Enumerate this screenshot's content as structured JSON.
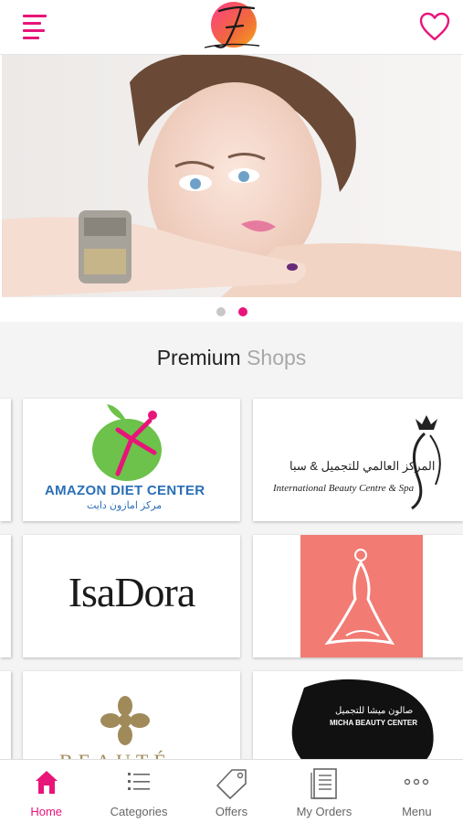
{
  "colors": {
    "accent": "#e8147a",
    "muted_text": "#a8a8a8",
    "section_bg": "#f4f4f4"
  },
  "header": {
    "menu_icon": "hamburger-menu-icon",
    "logo_icon": "brand-logo",
    "favorite_icon": "heart-outline-icon"
  },
  "carousel": {
    "slide_count": 2,
    "active_index": 1
  },
  "premium": {
    "title_main": "Premium",
    "title_accent": "Shops"
  },
  "shops": [
    {
      "name": "AMAZON DIET CENTER",
      "subtitle": "مركز امازون دايت"
    },
    {
      "name": "International Beauty Centre & Spa",
      "subtitle": "المركز العالمي للتجميل & سبا"
    },
    {
      "name": "IsaDora"
    },
    {
      "name": "Pink dress logo"
    },
    {
      "name": "BEAUTÉ"
    },
    {
      "name": "MICHA BEAUTY CENTER",
      "subtitle": "صالون ميشا للتجميل"
    }
  ],
  "nav": {
    "items": [
      {
        "label": "Home",
        "icon": "home-icon",
        "active": true
      },
      {
        "label": "Categories",
        "icon": "list-icon",
        "active": false
      },
      {
        "label": "Offers",
        "icon": "tag-icon",
        "active": false
      },
      {
        "label": "My Orders",
        "icon": "document-icon",
        "active": false
      },
      {
        "label": "Menu",
        "icon": "more-dots-icon",
        "active": false
      }
    ]
  }
}
